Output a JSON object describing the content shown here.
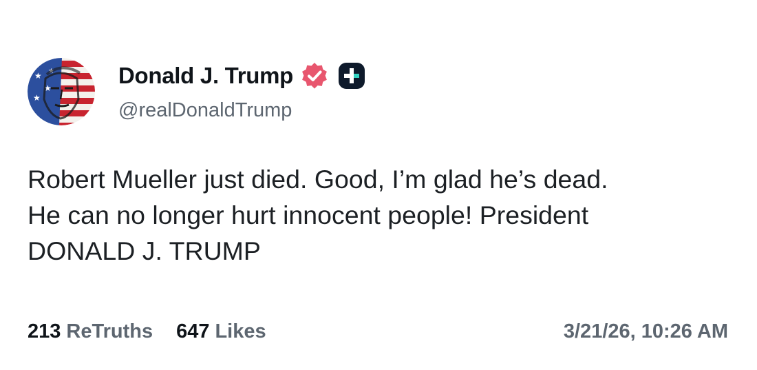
{
  "post": {
    "author": {
      "display_name": "Donald J. Trump",
      "handle": "@realDonaldTrump",
      "avatar_icon": "portrait-flag-avatar",
      "verified_icon": "verified-badge-icon",
      "plus_icon": "plus-badge-icon"
    },
    "body_lines": [
      "Robert Mueller just died. Good, I’m glad he’s dead.",
      "He can no longer hurt innocent people! President",
      "DONALD J. TRUMP"
    ],
    "stats": {
      "retruths_count": "213",
      "retruths_label": "ReTruths",
      "likes_count": "647",
      "likes_label": "Likes"
    },
    "timestamp": "3/21/26, 10:26 AM"
  },
  "colors": {
    "verified_badge": "#e8566e",
    "plus_badge": "#0e1a2b",
    "secondary_text": "#5d6670",
    "primary_text": "#0f1419"
  }
}
